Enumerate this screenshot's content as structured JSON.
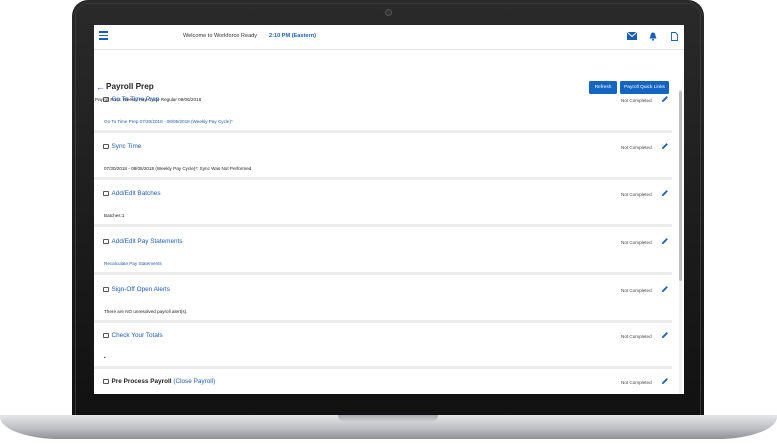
{
  "topbar": {
    "welcome": "Welcome to Workforce Ready",
    "time": "2:10 PM (Eastern)"
  },
  "header": {
    "title": "Payroll Prep",
    "subtitle": "Payroll Prep: Weekly Pay Cycle Regular 08/06/2018",
    "refresh_label": "Refresh",
    "quick_links_label": "Payroll Quick Links"
  },
  "tasks": [
    {
      "title": "Go To Time Prep",
      "status": "Not Completed",
      "detail": "Go To Time Prep 07/30/2018 - 08/05/2018 (Weekly Pay Cycle)*"
    },
    {
      "title": "Sync Time",
      "status": "Not Completed",
      "detail": "07/30/2018 - 08/05/2018 (Weekly Pay Cycle)*: Sync Was Not Performed"
    },
    {
      "title": "Add/Edit Batches",
      "status": "Not Completed",
      "detail": "Batches:1"
    },
    {
      "title": "Add/Edit Pay Statements",
      "status": "Not Completed",
      "detail": "Recalculate Pay Statements"
    },
    {
      "title": "Sign-Off Open Alerts",
      "status": "Not Completed",
      "detail": "There are NO unresolved payroll alert(s)."
    },
    {
      "title": "Check Your Totals",
      "status": "Not Completed",
      "detail": "•"
    },
    {
      "title": "Pre Process Payroll",
      "title_link": "(Close Payroll)",
      "status": "Not Completed",
      "detail": ""
    }
  ],
  "colors": {
    "accent": "#1a5fb4",
    "button": "#1565c0"
  }
}
